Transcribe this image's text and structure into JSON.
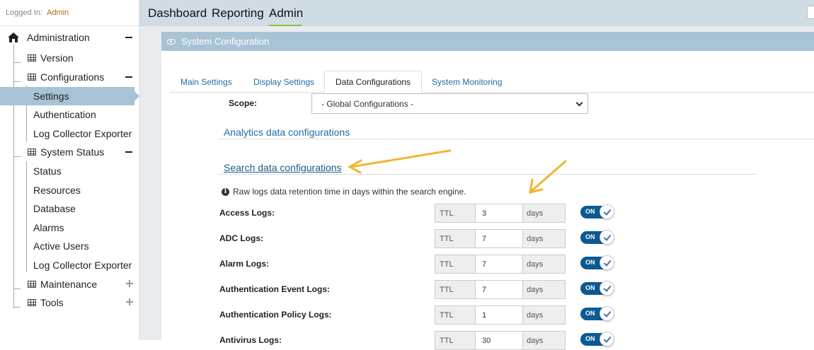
{
  "sidebar": {
    "logged_in_label": "Logged In:",
    "logged_in_user": "Admin",
    "root": {
      "label": "Administration",
      "icon": "home-icon"
    },
    "items": [
      {
        "label": "Version"
      },
      {
        "label": "Configurations"
      },
      {
        "label": "Settings",
        "selected": true
      },
      {
        "label": "Authentication"
      },
      {
        "label": "Log Collector Exporter"
      },
      {
        "label": "System Status"
      },
      {
        "label": "Status"
      },
      {
        "label": "Resources"
      },
      {
        "label": "Database"
      },
      {
        "label": "Alarms"
      },
      {
        "label": "Active Users"
      },
      {
        "label": "Log Collector Exporter"
      },
      {
        "label": "Maintenance"
      },
      {
        "label": "Tools"
      }
    ]
  },
  "topnav": {
    "tabs": [
      {
        "label": "Dashboard"
      },
      {
        "label": "Reporting"
      },
      {
        "label": "Admin",
        "active": true
      }
    ]
  },
  "panel": {
    "title": "System Configuration",
    "tabs": [
      {
        "label": "Main Settings"
      },
      {
        "label": "Display Settings"
      },
      {
        "label": "Data Configurations",
        "active": true
      },
      {
        "label": "System Monitoring"
      }
    ],
    "scope_label": "Scope:",
    "scope_value": "- Global Configurations -",
    "analytics_link": "Analytics data configurations",
    "search_link": "Search data configurations",
    "info_text": "Raw logs data retention time in days within the search engine.",
    "ttl_label": "TTL",
    "days_label": "days",
    "toggle_label": "ON",
    "logs": [
      {
        "label": "Access Logs:",
        "value": "3"
      },
      {
        "label": "ADC Logs:",
        "value": "7"
      },
      {
        "label": "Alarm Logs:",
        "value": "7"
      },
      {
        "label": "Authentication Event Logs:",
        "value": "7"
      },
      {
        "label": "Authentication Policy Logs:",
        "value": "1"
      },
      {
        "label": "Antivirus Logs:",
        "value": "30"
      }
    ]
  },
  "colors": {
    "accent_blue": "#a9c3d6",
    "link_blue": "#1f6ea5",
    "toggle_on": "#0b5a92",
    "active_underline": "#8ec03a",
    "annotation_arrow": "#f0b534"
  }
}
